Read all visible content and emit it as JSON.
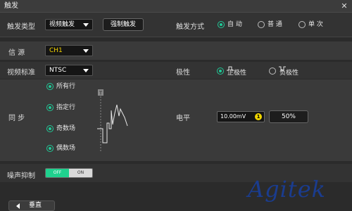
{
  "window": {
    "title": "触发"
  },
  "trigger_type": {
    "label": "触发类型",
    "value": "视频触发",
    "force_button": "强制触发"
  },
  "trigger_mode": {
    "label": "触发方式",
    "options": [
      {
        "label": "自 动",
        "selected": true
      },
      {
        "label": "普 通",
        "selected": false
      },
      {
        "label": "单 次",
        "selected": false
      }
    ]
  },
  "source": {
    "label": "信 源",
    "value": "CH1",
    "value_color": "#f5d400"
  },
  "video_standard": {
    "label": "视频标准",
    "value": "NTSC"
  },
  "polarity": {
    "label": "极性",
    "options": [
      {
        "label": "正极性",
        "selected": true,
        "icon": "positive-pulse-icon"
      },
      {
        "label": "负极性",
        "selected": false,
        "icon": "negative-pulse-icon"
      }
    ]
  },
  "sync": {
    "label": "同 步",
    "options": [
      {
        "label": "所有行",
        "selected": true
      },
      {
        "label": "指定行",
        "selected": false
      },
      {
        "label": "奇数场",
        "selected": false
      },
      {
        "label": "偶数场",
        "selected": false
      }
    ],
    "trigger_marker": "T"
  },
  "level": {
    "label": "电平",
    "value": "10.00mV",
    "knob": "1",
    "percent_button": "50%"
  },
  "noise_reject": {
    "label": "噪声抑制",
    "off": "OFF",
    "on": "ON",
    "state": "OFF"
  },
  "bottom": {
    "back_label": "垂直"
  },
  "watermark": "Agitek",
  "colors": {
    "accent": "#20c997",
    "toggle_off": "#1fd18e",
    "source": "#f5d400",
    "watermark": "#1a3c8f"
  }
}
